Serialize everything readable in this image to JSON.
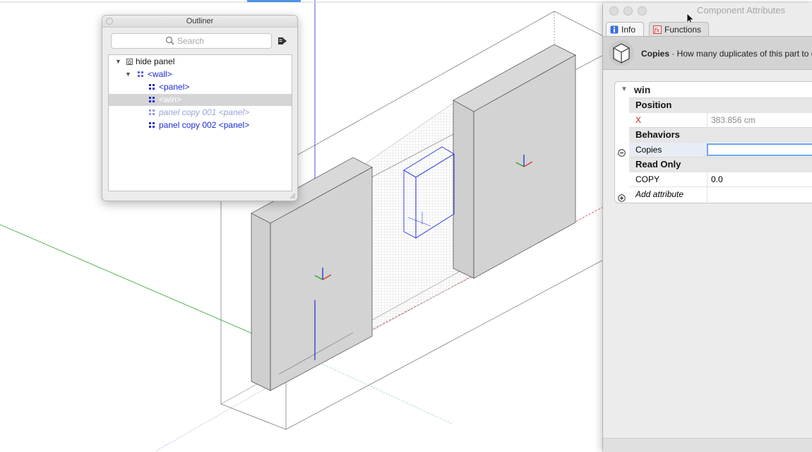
{
  "outliner": {
    "title": "Outliner",
    "search_placeholder": "Search",
    "tree": [
      {
        "label": "hide panel",
        "level": 0,
        "style": "dark",
        "icon": "house-icon",
        "expanded": true
      },
      {
        "label": "<wall>",
        "level": 1,
        "style": "blue",
        "icon": "component-icon",
        "expanded": true
      },
      {
        "label": "<panel>",
        "level": 2,
        "style": "blue",
        "icon": "component-icon"
      },
      {
        "label": "<win>",
        "level": 2,
        "style": "white",
        "icon": "component-icon",
        "selected": true
      },
      {
        "label": "panel copy 001 <panel>",
        "level": 2,
        "style": "ghost",
        "icon": "component-icon"
      },
      {
        "label": "panel copy 002 <panel>",
        "level": 2,
        "style": "blue",
        "icon": "component-icon"
      }
    ]
  },
  "attributes": {
    "title": "Component Attributes",
    "tabs": [
      {
        "label": "Info",
        "icon": "info-icon",
        "active": true
      },
      {
        "label": "Functions",
        "icon": "function-icon",
        "active": false
      }
    ],
    "info_title": "Copies",
    "info_text": " · How many duplicates of this part to c",
    "component_name": "win",
    "groups": [
      {
        "label": "Position",
        "rows": [
          {
            "name": "X",
            "value": "383.856 cm",
            "name_color": "#cc1f1f",
            "value_color": "#8a8a8a"
          }
        ]
      },
      {
        "label": "Behaviors",
        "rows": [
          {
            "name": "Copies",
            "value": "",
            "editing": true
          }
        ]
      },
      {
        "label": "Read Only",
        "rows": [
          {
            "name": "COPY",
            "value": "0.0"
          }
        ]
      }
    ],
    "add_attribute": "Add attribute"
  },
  "colors": {
    "axis_red": "#d12020",
    "axis_green": "#2aa62a",
    "axis_blue": "#1a2bd6",
    "selection_blue": "#2233dd"
  }
}
